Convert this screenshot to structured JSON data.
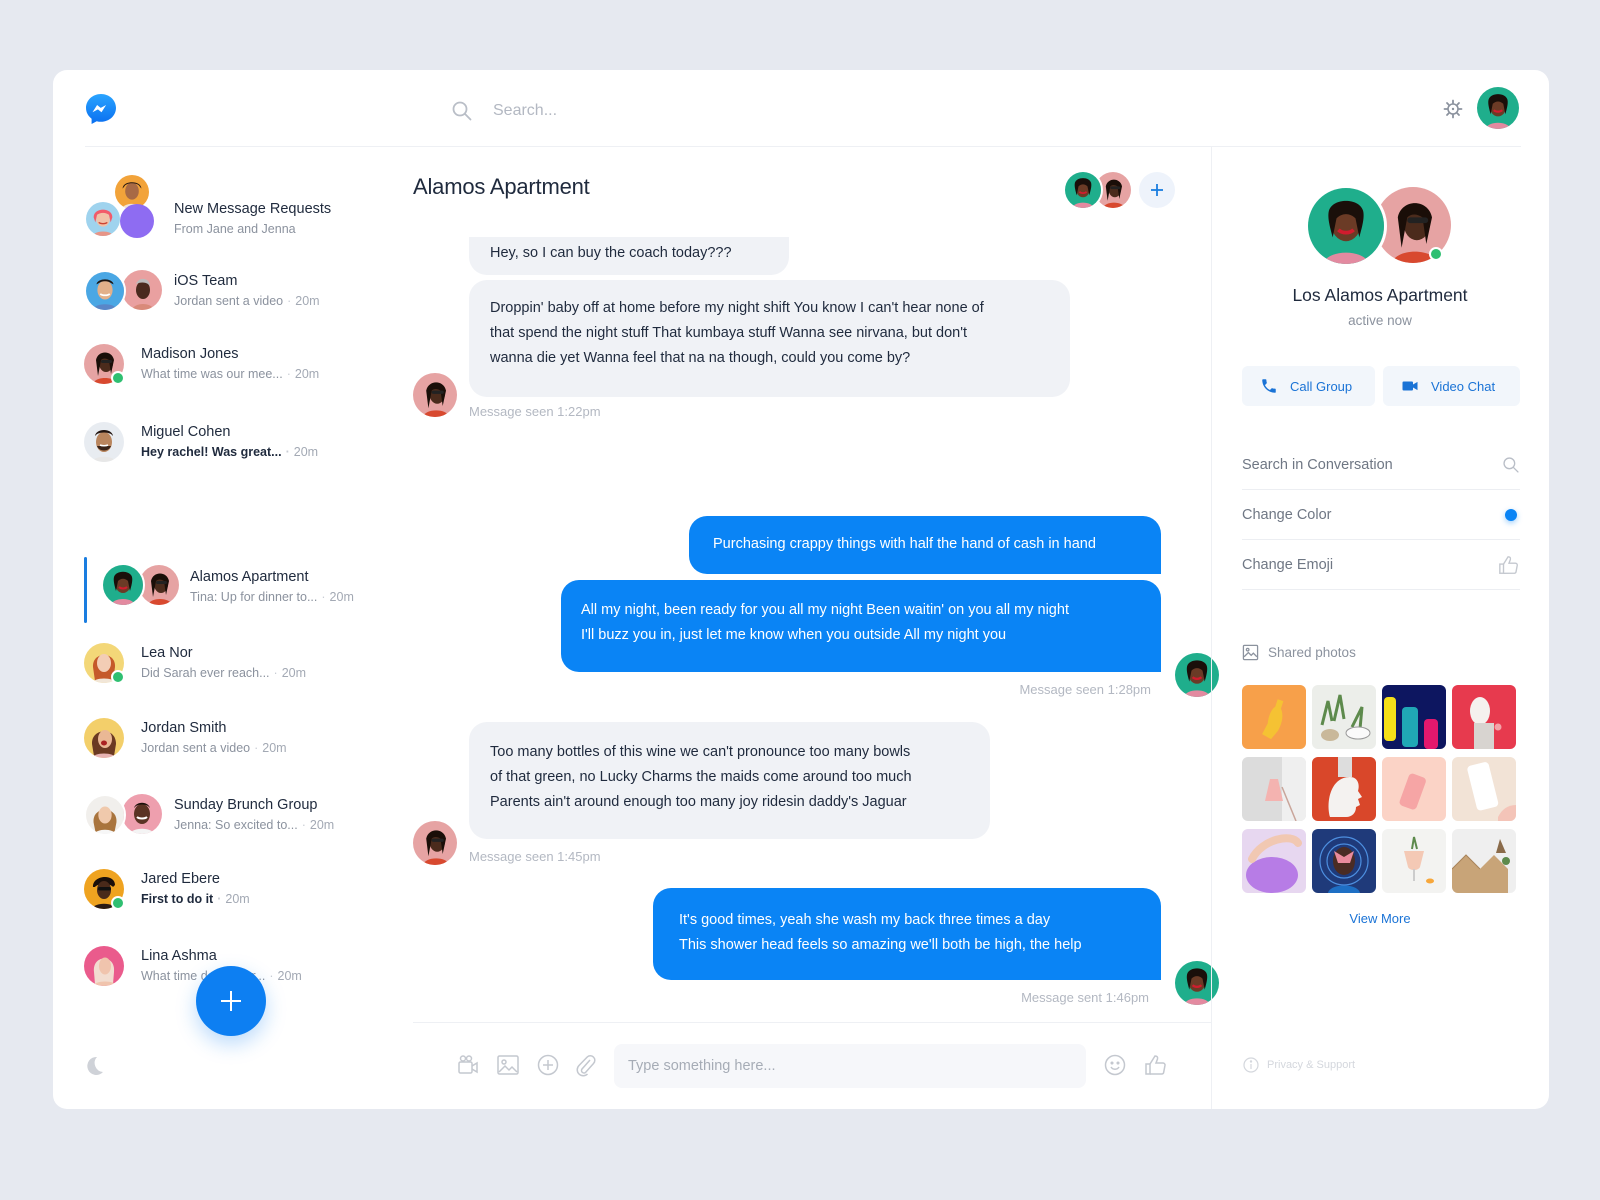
{
  "app": {
    "name": "Messenger",
    "brand_color": "#0a84f5"
  },
  "header": {
    "search_placeholder": "Search..."
  },
  "conversations": [
    {
      "name": "New Message Requests",
      "preview": "From Jane and Jenna",
      "time": "",
      "bold": false,
      "online": false,
      "active": false
    },
    {
      "name": "iOS Team",
      "preview": "Jordan sent a video",
      "time": "20m",
      "bold": false,
      "online": false,
      "active": false
    },
    {
      "name": "Madison Jones",
      "preview": "What time was our mee...",
      "time": "20m",
      "bold": false,
      "online": true,
      "active": false
    },
    {
      "name": "Miguel Cohen",
      "preview": "Hey rachel! Was great...",
      "time": "20m",
      "bold": true,
      "online": false,
      "active": false
    },
    {
      "name": "Alamos Apartment",
      "preview": "Tina: Up for dinner to...",
      "time": "20m",
      "bold": false,
      "online": false,
      "active": true
    },
    {
      "name": "Lea Nor",
      "preview": "Did Sarah ever reach...",
      "time": "20m",
      "bold": false,
      "online": true,
      "active": false
    },
    {
      "name": "Jordan Smith",
      "preview": "Jordan sent a video",
      "time": "20m",
      "bold": false,
      "online": false,
      "active": false
    },
    {
      "name": "Sunday Brunch Group",
      "preview": "Jenna: So excited to...",
      "time": "20m",
      "bold": false,
      "online": false,
      "active": false
    },
    {
      "name": "Jared Ebere",
      "preview": "First to do it",
      "time": "20m",
      "bold": true,
      "online": true,
      "active": false
    },
    {
      "name": "Lina Ashma",
      "preview": "What time does your...",
      "time": "20m",
      "bold": false,
      "online": false,
      "active": false
    }
  ],
  "chat": {
    "title": "Alamos Apartment",
    "messages": [
      {
        "direction": "in",
        "lines": [
          "Hey, so I can buy the coach today???"
        ],
        "meta": ""
      },
      {
        "direction": "in",
        "lines": [
          "Droppin' baby off at home before my night shift You know I can't hear none of",
          "that spend the night stuff That kumbaya stuff Wanna see nirvana, but don't",
          "wanna die yet Wanna feel that na na though, could you come by?"
        ],
        "meta": "Message seen 1:22pm"
      },
      {
        "direction": "out",
        "lines": [
          "Purchasing crappy things with half the hand of cash in hand"
        ],
        "meta": ""
      },
      {
        "direction": "out",
        "lines": [
          "All my night, been ready for you all my night Been waitin' on you all my night",
          "I'll buzz you in, just let me know when you outside All my night you"
        ],
        "meta": "Message seen 1:28pm"
      },
      {
        "direction": "in",
        "lines": [
          "Too many bottles of this wine we can't pronounce too many bowls",
          "of that green, no Lucky Charms the maids come around too much",
          "Parents ain't around enough too many joy ridesin daddy's Jaguar"
        ],
        "meta": "Message seen 1:45pm"
      },
      {
        "direction": "out",
        "lines": [
          "It's good times, yeah she wash my back three times a day",
          "This shower head feels so amazing we'll both be high, the help"
        ],
        "meta": "Message sent 1:46pm"
      }
    ],
    "composer_placeholder": "Type something here..."
  },
  "details": {
    "name": "Los Alamos Apartment",
    "status": "active now",
    "call_label": "Call Group",
    "video_label": "Video Chat",
    "options": [
      {
        "label": "Search in Conversation",
        "icon": "search-icon"
      },
      {
        "label": "Change Color",
        "icon": "color-dot-icon",
        "color": "#0a84f5"
      },
      {
        "label": "Change Emoji",
        "icon": "thumbs-up-icon"
      }
    ],
    "shared_photos_label": "Shared photos",
    "photos": [
      {
        "subject": "yellow bottle on orange",
        "colors": [
          "#f7a04a",
          "#f5c233"
        ]
      },
      {
        "subject": "potted plants",
        "colors": [
          "#eceeea",
          "#5d8a4c"
        ]
      },
      {
        "subject": "colored cans on navy",
        "colors": [
          "#0d1660",
          "#20a7b5"
        ]
      },
      {
        "subject": "white sculpture on red",
        "colors": [
          "#e73a4e",
          "#f1ecea"
        ]
      },
      {
        "subject": "pink lamp",
        "colors": [
          "#dcdcdc",
          "#f4b3b0"
        ]
      },
      {
        "subject": "white head bust on orange",
        "colors": [
          "#d9472a",
          "#f4f2f0"
        ]
      },
      {
        "subject": "pink cup on peach",
        "colors": [
          "#fbd3c6",
          "#f6a5a5"
        ]
      },
      {
        "subject": "white bottle on beige",
        "colors": [
          "#f2e3d6",
          "#ffffff"
        ]
      },
      {
        "subject": "hand on purple",
        "colors": [
          "#e7d7f0",
          "#b77ce6"
        ]
      },
      {
        "subject": "portrait illustration",
        "colors": [
          "#1f3a7a",
          "#e98b9c"
        ]
      },
      {
        "subject": "drink glass",
        "colors": [
          "#f3f3f1",
          "#f4c9b5"
        ]
      },
      {
        "subject": "wooden shelves",
        "colors": [
          "#efefef",
          "#c8a478"
        ]
      }
    ],
    "view_more_label": "View More",
    "privacy_label": "Privacy & Support"
  }
}
